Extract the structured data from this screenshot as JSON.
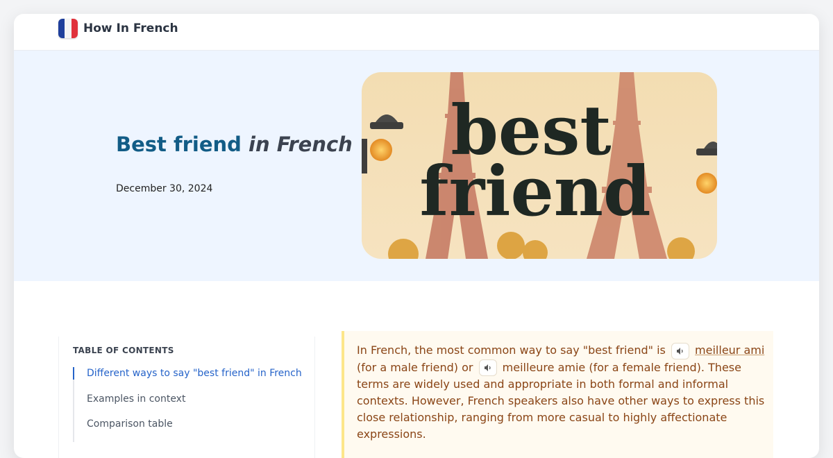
{
  "site": {
    "name": "How In French"
  },
  "hero": {
    "title_strong": "Best friend",
    "title_em": "in French",
    "date": "December 30, 2024",
    "image_word1": "best",
    "image_word2": "friend"
  },
  "toc": {
    "heading": "TABLE OF CONTENTS",
    "items": [
      "Different ways to say \"best friend\" in French",
      "Examples in context",
      "Comparison table"
    ]
  },
  "intro": {
    "part1": "In French, the most common way to say \"best friend\" is",
    "term1": "meilleur ami",
    "part2": "(for a male friend) or",
    "term2": "meilleure amie",
    "part3": "(for a female friend). These terms are widely used and appropriate in both formal and informal contexts. However, French speakers also have other ways to express this close relationship, ranging from more casual to highly affectionate expressions."
  },
  "colors": {
    "accent": "#2563c9",
    "title": "#125c86",
    "note_text": "#8a4516",
    "note_border": "#fde68a",
    "hero_bg": "#eef5ff"
  },
  "icons": {
    "flag": "france-flag-icon",
    "speaker": "speaker-icon"
  }
}
